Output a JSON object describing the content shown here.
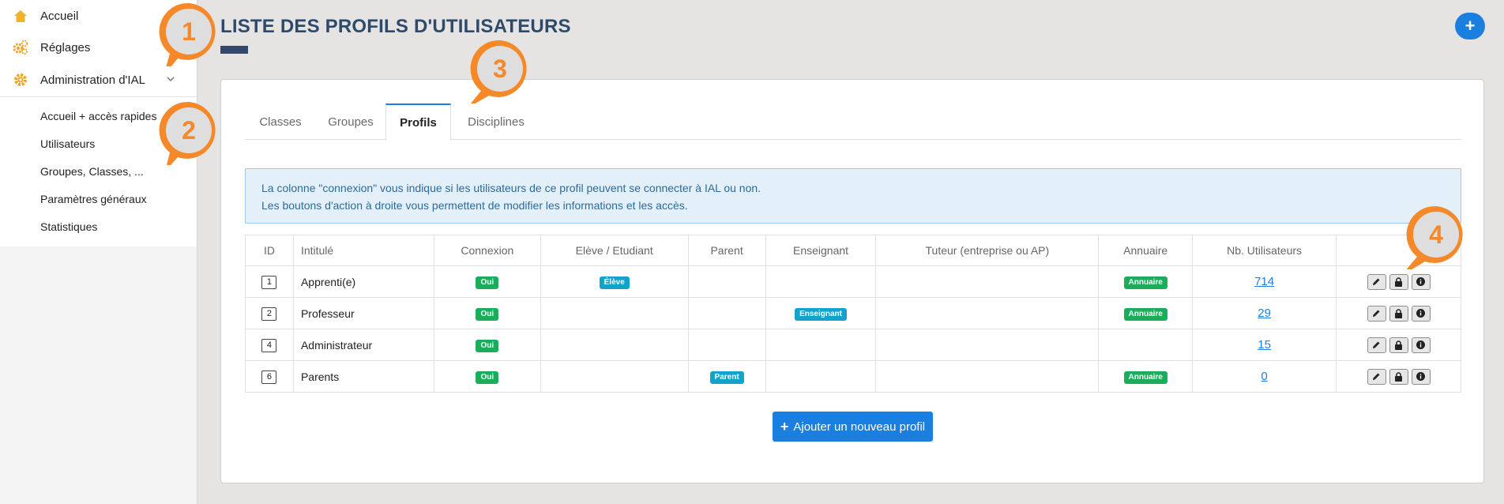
{
  "sidebar": {
    "items": [
      {
        "label": "Accueil",
        "icon": "home-icon"
      },
      {
        "label": "Réglages",
        "icon": "gears-icon"
      },
      {
        "label": "Administration d'IAL",
        "icon": "gear-icon"
      }
    ],
    "sub_items": [
      {
        "label": "Accueil + accès rapides"
      },
      {
        "label": "Utilisateurs"
      },
      {
        "label": "Groupes, Classes, ..."
      },
      {
        "label": "Paramètres généraux"
      },
      {
        "label": "Statistiques"
      }
    ]
  },
  "header": {
    "title": "LISTE DES PROFILS D'UTILISATEURS",
    "add_button_icon": "+"
  },
  "tabs": [
    {
      "label": "Classes"
    },
    {
      "label": "Groupes"
    },
    {
      "label": "Profils",
      "active": true
    },
    {
      "label": "Disciplines"
    }
  ],
  "info": {
    "line1": "La colonne \"connexion\" vous indique si les utilisateurs de ce profil peuvent se connecter à IAL ou non.",
    "line2": "Les boutons d'action à droite vous permettent de modifier les informations et les accès."
  },
  "table": {
    "headers": [
      "ID",
      "Intitulé",
      "Connexion",
      "Elève / Etudiant",
      "Parent",
      "Enseignant",
      "Tuteur (entreprise ou AP)",
      "Annuaire",
      "Nb. Utilisateurs",
      ""
    ],
    "rows": [
      {
        "id": "1",
        "name": "Apprenti(e)",
        "connexion": "Oui",
        "eleve": "Élève",
        "parent": "",
        "enseignant": "",
        "tuteur": "",
        "annuaire": "Annuaire",
        "count": "714"
      },
      {
        "id": "2",
        "name": "Professeur",
        "connexion": "Oui",
        "eleve": "",
        "parent": "",
        "enseignant": "Enseignant",
        "tuteur": "",
        "annuaire": "Annuaire",
        "count": "29"
      },
      {
        "id": "4",
        "name": "Administrateur",
        "connexion": "Oui",
        "eleve": "",
        "parent": "",
        "enseignant": "",
        "tuteur": "",
        "annuaire": "",
        "count": "15"
      },
      {
        "id": "6",
        "name": "Parents",
        "connexion": "Oui",
        "eleve": "",
        "parent": "Parent",
        "enseignant": "",
        "tuteur": "",
        "annuaire": "Annuaire",
        "count": "0"
      }
    ]
  },
  "add_profile_button": "Ajouter un nouveau profil",
  "callouts": [
    "1",
    "2",
    "3",
    "4"
  ],
  "colors": {
    "accent": "#1b7fe0",
    "title": "#2e4a6b",
    "badge_green": "#1aae5b",
    "badge_cyan": "#12a2cc",
    "callout": "#f5892a",
    "sidebar_icon": "#f0a227"
  }
}
